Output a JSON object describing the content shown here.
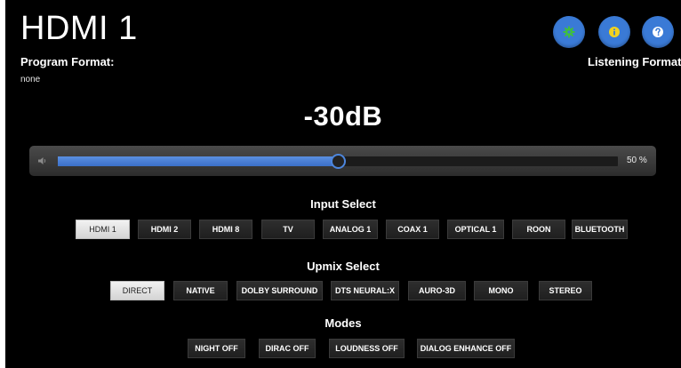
{
  "header": {
    "source_title": "HDMI 1",
    "program_format_label": "Program Format:",
    "program_format_value": "none",
    "listening_format_label": "Listening Format:"
  },
  "top_buttons": {
    "settings_icon": "gear-icon",
    "info_icon": "info-icon",
    "help_icon": "question-icon",
    "button_color": "#3a7ad6",
    "settings_glyph_color": "#3fbf3f",
    "info_glyph_color": "#f2d21e"
  },
  "volume": {
    "readout": "-30dB",
    "percent_label": "50 %",
    "level_fraction": 0.5,
    "speaker_icon": "speaker-icon",
    "fill_color": "#3b6fc8"
  },
  "input_select": {
    "title": "Input Select",
    "items": [
      "HDMI 1",
      "HDMI 2",
      "HDMI 8",
      "TV",
      "ANALOG 1",
      "COAX 1",
      "OPTICAL 1",
      "ROON",
      "BLUETOOTH"
    ],
    "selected": "HDMI 1"
  },
  "upmix_select": {
    "title": "Upmix Select",
    "items": [
      "DIRECT",
      "NATIVE",
      "DOLBY SURROUND",
      "DTS NEURAL:X",
      "AURO-3D",
      "MONO",
      "STEREO"
    ],
    "selected": "DIRECT"
  },
  "modes": {
    "title": "Modes",
    "items": [
      "NIGHT OFF",
      "DIRAC OFF",
      "LOUDNESS OFF",
      "DIALOG ENHANCE OFF"
    ]
  }
}
